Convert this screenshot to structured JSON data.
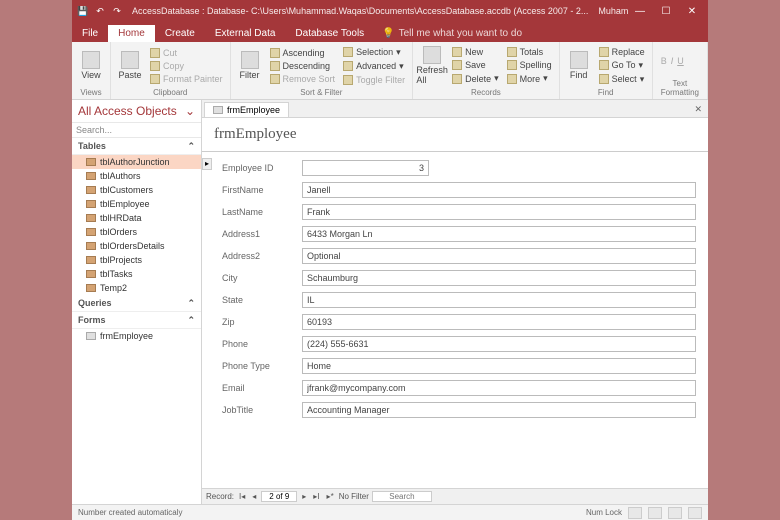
{
  "titlebar": {
    "title": "AccessDatabase : Database- C:\\Users\\Muhammad.Waqas\\Documents\\AccessDatabase.accdb (Access 2007 - 2...",
    "user": "Muhammad Waqas"
  },
  "tabs": {
    "file": "File",
    "home": "Home",
    "create": "Create",
    "external": "External Data",
    "dbtools": "Database Tools",
    "tellme": "Tell me what you want to do"
  },
  "ribbon": {
    "views": {
      "label": "Views",
      "view": "View"
    },
    "clipboard": {
      "label": "Clipboard",
      "paste": "Paste",
      "cut": "Cut",
      "copy": "Copy",
      "format": "Format Painter"
    },
    "sortfilter": {
      "label": "Sort & Filter",
      "filter": "Filter",
      "asc": "Ascending",
      "desc": "Descending",
      "remove": "Remove Sort",
      "selection": "Selection",
      "advanced": "Advanced",
      "toggle": "Toggle Filter"
    },
    "records": {
      "label": "Records",
      "refresh": "Refresh All",
      "new": "New",
      "save": "Save",
      "delete": "Delete",
      "totals": "Totals",
      "spelling": "Spelling",
      "more": "More"
    },
    "find": {
      "label": "Find",
      "find": "Find",
      "replace": "Replace",
      "goto": "Go To",
      "select": "Select"
    },
    "textfmt": {
      "label": "Text Formatting"
    }
  },
  "nav": {
    "header": "All Access Objects",
    "search": "Search...",
    "groups": {
      "tables": "Tables",
      "queries": "Queries",
      "forms": "Forms"
    },
    "tables": [
      "tblAuthorJunction",
      "tblAuthors",
      "tblCustomers",
      "tblEmployee",
      "tblHRData",
      "tblOrders",
      "tblOrdersDetails",
      "tblProjects",
      "tblTasks",
      "Temp2"
    ],
    "forms": [
      "frmEmployee"
    ]
  },
  "doctab": {
    "name": "frmEmployee"
  },
  "form": {
    "title": "frmEmployee",
    "labels": {
      "id": "Employee ID",
      "fn": "FirstName",
      "ln": "LastName",
      "a1": "Address1",
      "a2": "Address2",
      "city": "City",
      "state": "State",
      "zip": "Zip",
      "phone": "Phone",
      "ptype": "Phone Type",
      "email": "Email",
      "job": "JobTitle"
    },
    "values": {
      "id": "3",
      "fn": "Janell",
      "ln": "Frank",
      "a1": "6433 Morgan Ln",
      "a2": "Optional",
      "city": "Schaumburg",
      "state": "IL",
      "zip": "60193",
      "phone": "(224) 555-6631",
      "ptype": "Home",
      "email": "jfrank@mycompany.com",
      "job": "Accounting Manager"
    }
  },
  "recnav": {
    "label": "Record:",
    "pos": "2 of 9",
    "nofilter": "No Filter",
    "search": "Search"
  },
  "status": {
    "left": "Number created automaticaly",
    "numlock": "Num Lock"
  }
}
